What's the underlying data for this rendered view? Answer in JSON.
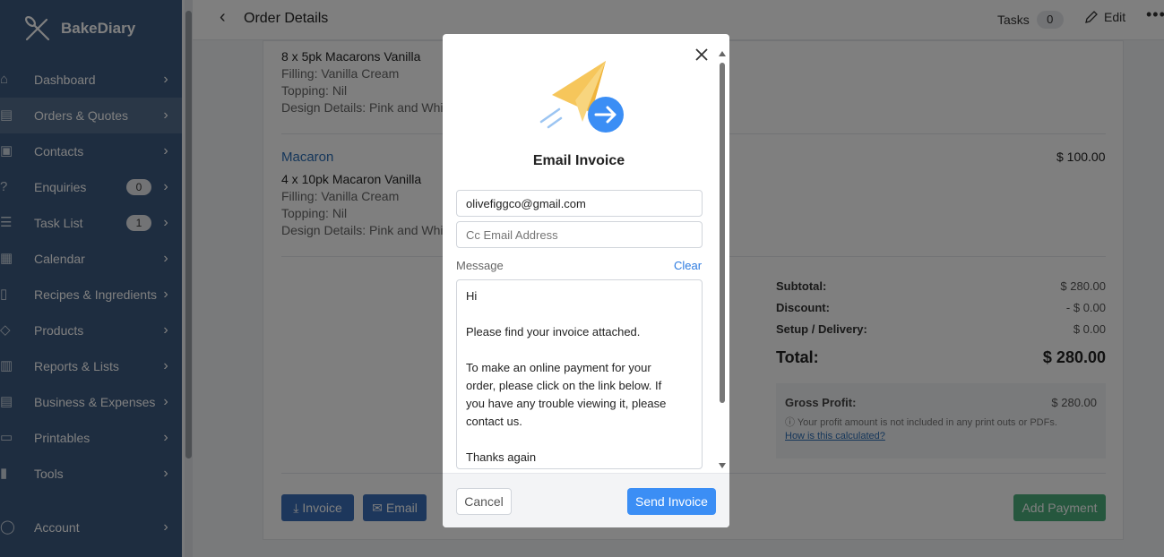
{
  "app": {
    "name": "BakeDiary"
  },
  "sidebar": {
    "items": [
      {
        "label": "Dashboard",
        "icon": "home-icon"
      },
      {
        "label": "Orders & Quotes",
        "icon": "clipboard-icon"
      },
      {
        "label": "Contacts",
        "icon": "contacts-icon"
      },
      {
        "label": "Enquiries",
        "icon": "enquiry-icon",
        "badge": "0"
      },
      {
        "label": "Task List",
        "icon": "tasklist-icon",
        "badge": "1"
      },
      {
        "label": "Calendar",
        "icon": "calendar-icon"
      },
      {
        "label": "Recipes & Ingredients",
        "icon": "book-icon"
      },
      {
        "label": "Products",
        "icon": "tag-icon"
      },
      {
        "label": "Reports & Lists",
        "icon": "report-icon"
      },
      {
        "label": "Business & Expenses",
        "icon": "ledger-icon"
      },
      {
        "label": "Printables",
        "icon": "printer-icon"
      },
      {
        "label": "Tools",
        "icon": "tools-icon"
      },
      {
        "label": "Account",
        "icon": "account-icon"
      }
    ]
  },
  "header": {
    "title": "Order Details",
    "tasks_label": "Tasks",
    "tasks_count": "0",
    "edit_label": "Edit",
    "more_label": "•••"
  },
  "order": {
    "item1": {
      "line": "8 x 5pk Macarons Vanilla",
      "filling": "Filling: Vanilla Cream",
      "topping": "Topping: Nil",
      "design": "Design Details: Pink and White"
    },
    "item2": {
      "name": "Macaron",
      "price": "$ 100.00",
      "line": "4 x 10pk Macaron Vanilla",
      "filling": "Filling: Vanilla Cream",
      "topping": "Topping: Nil",
      "design": "Design Details: Pink and White"
    },
    "totals": {
      "subtotal_label": "Subtotal:",
      "subtotal": "$ 280.00",
      "discount_label": "Discount:",
      "discount": "- $ 0.00",
      "setup_label": "Setup / Delivery:",
      "setup": "$ 0.00",
      "total_label": "Total:",
      "total": "$ 280.00"
    },
    "profit": {
      "label": "Gross Profit:",
      "value": "$ 280.00",
      "note": "ⓘ Your profit amount is not included in any print outs or PDFs.",
      "link": "How is this calculated?"
    },
    "buttons": {
      "invoice": "Invoice",
      "email": "Email",
      "add_payment": "Add Payment"
    }
  },
  "modal": {
    "title": "Email Invoice",
    "to_value": "olivefiggco@gmail.com",
    "cc_placeholder": "Cc Email Address",
    "message_label": "Message",
    "clear_label": "Clear",
    "message_lines": [
      "Hi",
      "",
      "Please find your invoice attached.",
      "",
      "To make an online payment for your",
      "order, please click on the link below. If",
      "you have any trouble viewing it, please",
      "contact us.",
      "",
      "Thanks again"
    ],
    "cancel_label": "Cancel",
    "send_label": "Send Invoice"
  },
  "colors": {
    "sidebar": "#3d5a80",
    "primary": "#3b8ef5",
    "button_blue": "#3b6fb8",
    "button_green": "#4caf7d",
    "link": "#2d6fb6"
  }
}
